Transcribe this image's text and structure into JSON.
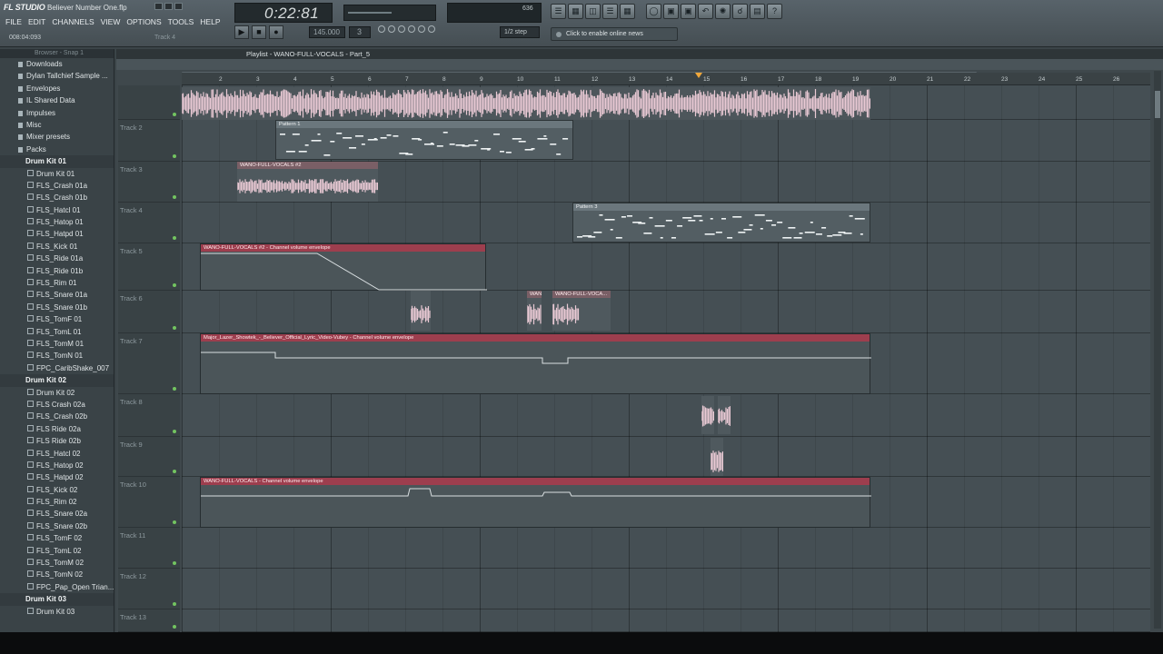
{
  "app": {
    "logo": "FL STUDIO",
    "song_title": "Believer Number One.flp",
    "menu": [
      "FILE",
      "EDIT",
      "CHANNELS",
      "VIEW",
      "OPTIONS",
      "TOOLS",
      "HELP"
    ],
    "hint_position": "008:04:093",
    "hint_track": "Track 4"
  },
  "transport": {
    "time": "0:22:81",
    "tempo": "145.000",
    "pattern": "3",
    "step": "1/2 step",
    "cpu": "636",
    "news": "Click to enable online news"
  },
  "browser": {
    "title": "Browser - Snap 1",
    "items": [
      {
        "type": "folder",
        "label": "Downloads"
      },
      {
        "type": "folder",
        "label": "Dylan Tallchief Sample ..."
      },
      {
        "type": "folder",
        "label": "Envelopes"
      },
      {
        "type": "folder",
        "label": "IL Shared Data"
      },
      {
        "type": "folder",
        "label": "Impulses"
      },
      {
        "type": "folder",
        "label": "Misc"
      },
      {
        "type": "folder",
        "label": "Mixer presets"
      },
      {
        "type": "folder",
        "label": "Packs"
      },
      {
        "type": "section",
        "label": "Drum Kit 01"
      },
      {
        "type": "file",
        "label": "Drum Kit 01"
      },
      {
        "type": "file",
        "label": "FLS_Crash 01a"
      },
      {
        "type": "file",
        "label": "FLS_Crash 01b"
      },
      {
        "type": "file",
        "label": "FLS_Hatcl 01"
      },
      {
        "type": "file",
        "label": "FLS_Hatop 01"
      },
      {
        "type": "file",
        "label": "FLS_Hatpd 01"
      },
      {
        "type": "file",
        "label": "FLS_Kick 01"
      },
      {
        "type": "file",
        "label": "FLS_Ride 01a"
      },
      {
        "type": "file",
        "label": "FLS_Ride 01b"
      },
      {
        "type": "file",
        "label": "FLS_Rim 01"
      },
      {
        "type": "file",
        "label": "FLS_Snare 01a"
      },
      {
        "type": "file",
        "label": "FLS_Snare 01b"
      },
      {
        "type": "file",
        "label": "FLS_TomF 01"
      },
      {
        "type": "file",
        "label": "FLS_TomL 01"
      },
      {
        "type": "file",
        "label": "FLS_TomM 01"
      },
      {
        "type": "file",
        "label": "FLS_TomN 01"
      },
      {
        "type": "file",
        "label": "FPC_CaribShake_007"
      },
      {
        "type": "section",
        "label": "Drum Kit 02"
      },
      {
        "type": "file",
        "label": "Drum Kit 02"
      },
      {
        "type": "file",
        "label": "FLS Crash 02a"
      },
      {
        "type": "file",
        "label": "FLS_Crash 02b"
      },
      {
        "type": "file",
        "label": "FLS Ride 02a"
      },
      {
        "type": "file",
        "label": "FLS Ride 02b"
      },
      {
        "type": "file",
        "label": "FLS_Hatcl 02"
      },
      {
        "type": "file",
        "label": "FLS_Hatop 02"
      },
      {
        "type": "file",
        "label": "FLS_Hatpd 02"
      },
      {
        "type": "file",
        "label": "FLS_Kick 02"
      },
      {
        "type": "file",
        "label": "FLS_Rim 02"
      },
      {
        "type": "file",
        "label": "FLS_Snare 02a"
      },
      {
        "type": "file",
        "label": "FLS_Snare 02b"
      },
      {
        "type": "file",
        "label": "FLS_TomF 02"
      },
      {
        "type": "file",
        "label": "FLS_TomL 02"
      },
      {
        "type": "file",
        "label": "FLS_TomM 02"
      },
      {
        "type": "file",
        "label": "FLS_TomN 02"
      },
      {
        "type": "file",
        "label": "FPC_Pap_Open Trian..."
      },
      {
        "type": "section",
        "label": "Drum Kit 03"
      },
      {
        "type": "file",
        "label": "Drum Kit 03"
      }
    ]
  },
  "playlist": {
    "title": "Playlist - WANO-FULL-VOCALS - Part_5",
    "ruler": [
      "2",
      "3",
      "4",
      "5",
      "6",
      "7",
      "8",
      "9",
      "10",
      "11",
      "12",
      "13",
      "14",
      "15",
      "16",
      "17",
      "18",
      "19",
      "20",
      "21",
      "22",
      "23",
      "24",
      "25",
      "26"
    ],
    "tracks": [
      "Track 1",
      "Track 2",
      "Track 3",
      "Track 4",
      "Track 5",
      "Track 6",
      "Track 7",
      "Track 8",
      "Track 9",
      "Track 10",
      "Track 11",
      "Track 12",
      "Track 13"
    ],
    "clips": {
      "pattern1": "Pattern 1",
      "vocals2": "WANO-FULL-VOCALS #2",
      "pattern3": "Pattern 3",
      "env_vocals2": "WANO-FULL-VOCALS #2 - Channel volume envelope",
      "wan_short": "WAN...",
      "wano_vocal": "WANO-FULL-VOCA...",
      "env_major": "Major_Lazer_Showtek_-_Believer_Official_Lyric_Video-Vubey - Channel volume envelope",
      "env_vocals": "WANO-FULL-VOCALS - Channel volume envelope"
    }
  },
  "colors": {
    "envelope_header": "#9d3e4e",
    "audio_wave": "#e9c9d4",
    "pattern_note": "#eef2f3",
    "track_bg": "#454f54"
  }
}
